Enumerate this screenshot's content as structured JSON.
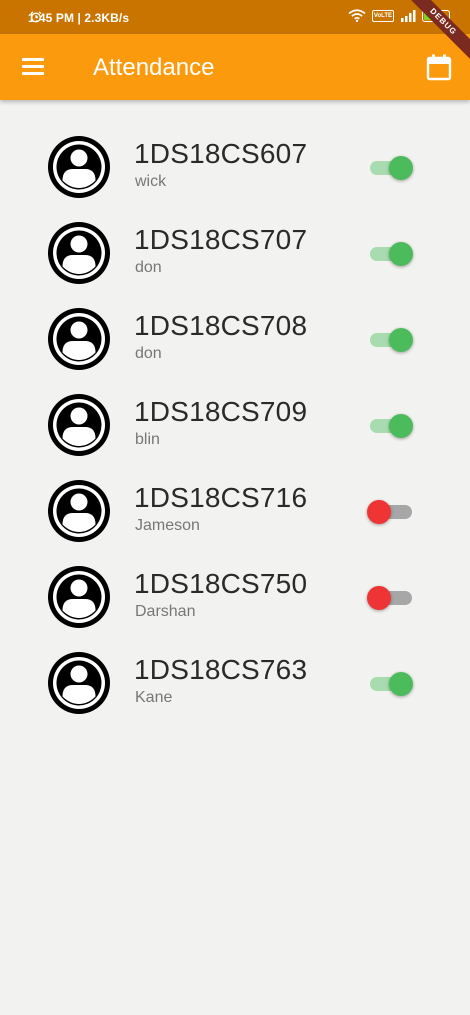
{
  "status_bar": {
    "time": "1:45 PM | 2.3KB/s",
    "network_badge": "VoLTE",
    "battery_level": "67",
    "battery_fraction": 0.67,
    "debug_label": "DEBUG"
  },
  "app_bar": {
    "title": "Attendance",
    "menu_icon": "menu-icon",
    "calendar_icon": "calendar-icon",
    "color": "#fb9a0c"
  },
  "colors": {
    "switch_on": "#4cbb5c",
    "switch_off": "#ee3434"
  },
  "students": [
    {
      "usn": "1DS18CS607",
      "name": "wick",
      "present": true
    },
    {
      "usn": "1DS18CS707",
      "name": "don",
      "present": true
    },
    {
      "usn": "1DS18CS708",
      "name": "don",
      "present": true
    },
    {
      "usn": "1DS18CS709",
      "name": "blin",
      "present": true
    },
    {
      "usn": "1DS18CS716",
      "name": "Jameson",
      "present": false
    },
    {
      "usn": "1DS18CS750",
      "name": "Darshan",
      "present": false
    },
    {
      "usn": "1DS18CS763",
      "name": "Kane",
      "present": true
    }
  ]
}
